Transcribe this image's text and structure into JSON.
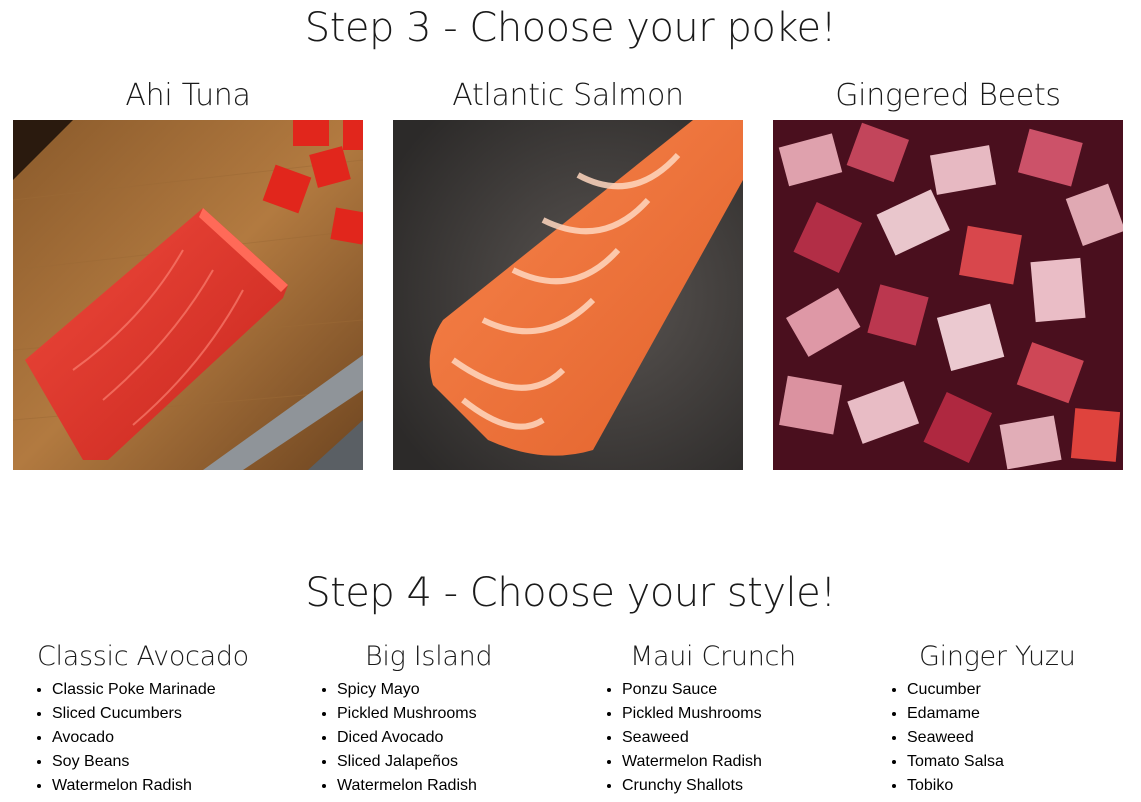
{
  "step3": {
    "title": "Step 3 - Choose your poke!",
    "items": [
      {
        "name": "Ahi Tuna",
        "image": "ahi-tuna-photo"
      },
      {
        "name": "Atlantic Salmon",
        "image": "salmon-photo"
      },
      {
        "name": "Gingered Beets",
        "image": "beets-photo"
      }
    ]
  },
  "step4": {
    "title": "Step 4 - Choose your style!",
    "styles": [
      {
        "name": "Classic Avocado",
        "ingredients": [
          "Classic Poke Marinade",
          "Sliced Cucumbers",
          "Avocado",
          "Soy Beans",
          "Watermelon Radish"
        ]
      },
      {
        "name": "Big Island",
        "ingredients": [
          "Spicy Mayo",
          "Pickled Mushrooms",
          "Diced Avocado",
          "Sliced Jalapeños",
          "Watermelon Radish"
        ]
      },
      {
        "name": "Maui Crunch",
        "ingredients": [
          "Ponzu Sauce",
          "Pickled Mushrooms",
          "Seaweed",
          "Watermelon Radish",
          "Crunchy Shallots"
        ]
      },
      {
        "name": "Ginger Yuzu",
        "ingredients": [
          "Cucumber",
          "Edamame",
          "Seaweed",
          "Tomato Salsa",
          "Tobiko"
        ]
      }
    ]
  }
}
